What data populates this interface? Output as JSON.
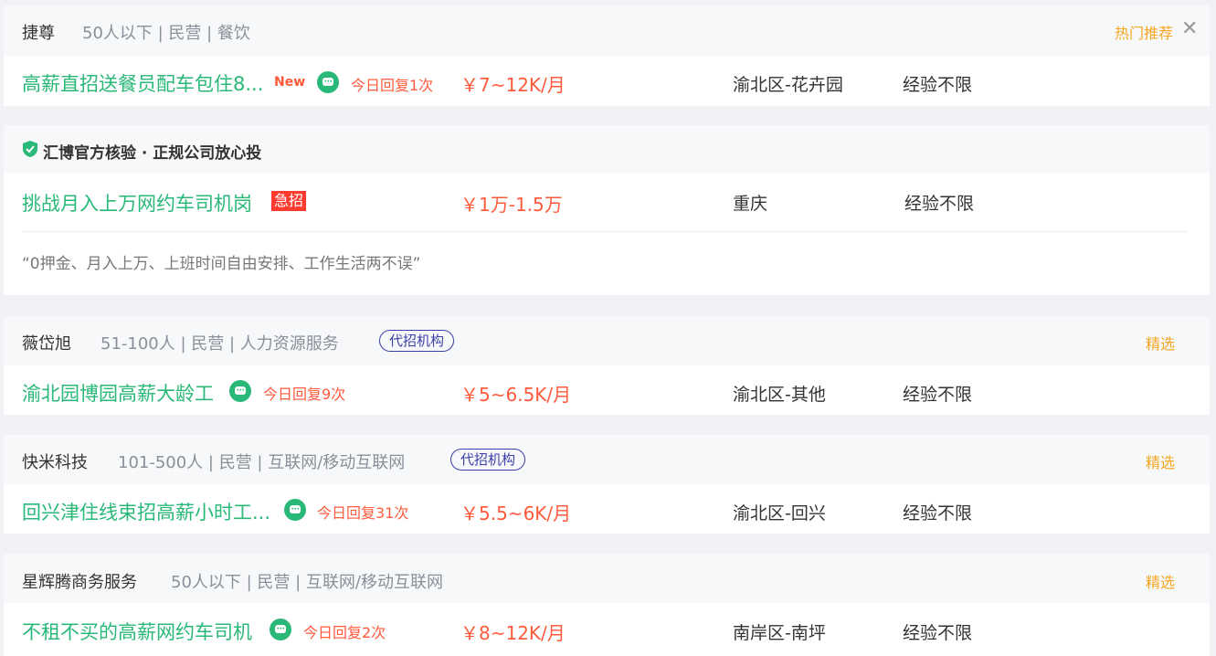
{
  "cards": [
    {
      "company": "捷尊",
      "meta": "50人以下 | 民营 | 餐饮",
      "label": "热门推荐",
      "title": "高薪直招送餐员配车包住8...",
      "new_tag": "New",
      "reply": "今日回复1次",
      "salary": "￥7~12K/月",
      "location": "渝北区-花卉园",
      "experience": "经验不限"
    },
    {
      "verify_text": "汇博官方核验 · 正规公司放心投",
      "title": "挑战月入上万网约车司机岗",
      "urgent_tag": "急招",
      "salary": "￥1万-1.5万",
      "location": "重庆",
      "experience": "经验不限",
      "description": "“0押金、月入上万、上班时间自由安排、工作生活两不误”"
    },
    {
      "company": "薇岱旭",
      "meta": "51-100人 | 民营 | 人力资源服务",
      "agency_tag": "代招机构",
      "label": "精选",
      "title": "渝北园博园高薪大龄工",
      "reply": "今日回复9次",
      "salary": "￥5~6.5K/月",
      "location": "渝北区-其他",
      "experience": "经验不限"
    },
    {
      "company": "快米科技",
      "meta": "101-500人 | 民营 | 互联网/移动互联网",
      "agency_tag": "代招机构",
      "label": "精选",
      "title": "回兴津住线束招高薪小时工...",
      "reply": "今日回复31次",
      "salary": "￥5.5~6K/月",
      "location": "渝北区-回兴",
      "experience": "经验不限"
    },
    {
      "company": "星辉腾商务服务",
      "meta": "50人以下 | 民营 | 互联网/移动互联网",
      "label": "精选",
      "title": "不租不买的高薪网约车司机",
      "reply": "今日回复2次",
      "salary": "￥8~12K/月",
      "location": "南岸区-南坪",
      "experience": "经验不限"
    }
  ],
  "icons": {
    "chat": "chat-bubble-icon",
    "close": "close-icon",
    "shield": "shield-check-icon"
  },
  "colors": {
    "title_green": "#29b877",
    "salary_red": "#ff5a3c",
    "label_orange": "#f5a623",
    "agency_blue": "#3b3fa8"
  }
}
